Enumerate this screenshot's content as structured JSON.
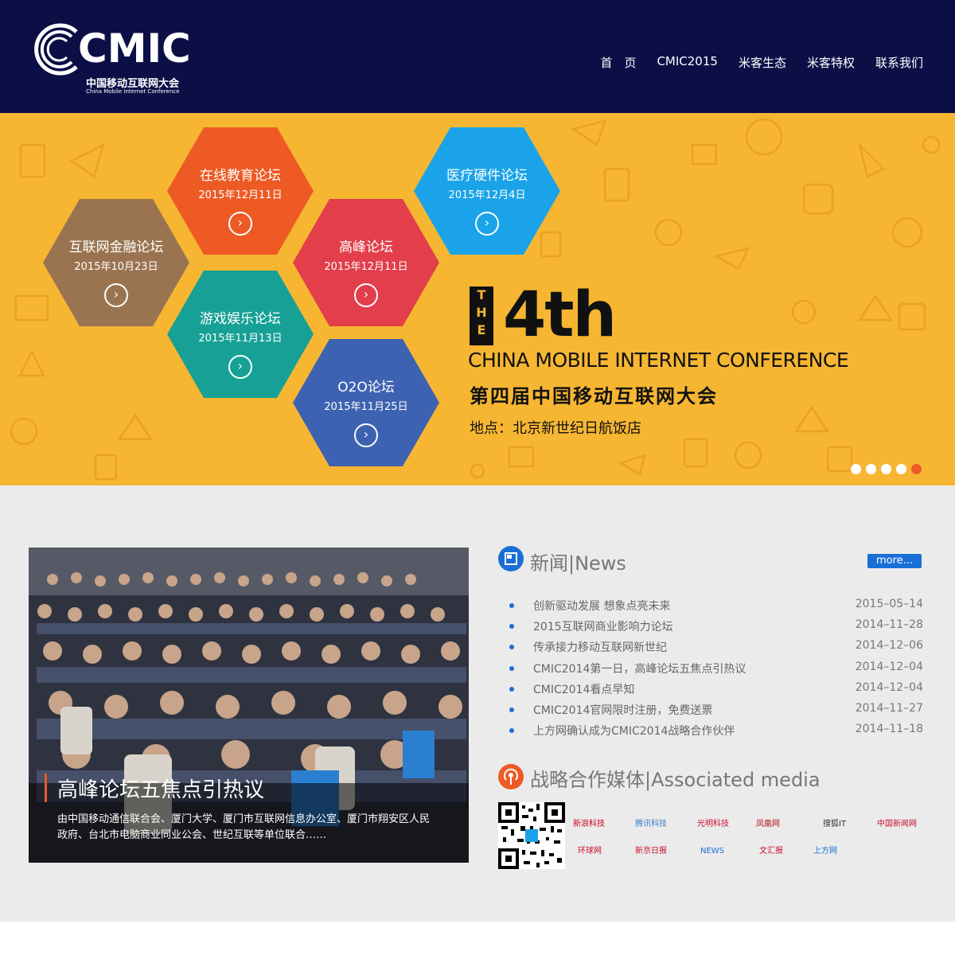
{
  "header": {
    "logo_text": "CMIC",
    "logo_cn": "中国移动互联网大会",
    "logo_en": "China Mobile Internet Conference",
    "nav": [
      "首　页",
      "CMIC2015",
      "米客生态",
      "米客特权",
      "联系我们"
    ]
  },
  "banner": {
    "forums": [
      {
        "title": "在线教育论坛",
        "date": "2015年12月11日",
        "color": "#ee5a24"
      },
      {
        "title": "医疗硬件论坛",
        "date": "2015年12月4日",
        "color": "#1aa3e8"
      },
      {
        "title": "互联网金融论坛",
        "date": "2015年10月23日",
        "color": "#9a7450"
      },
      {
        "title": "高峰论坛",
        "date": "2015年12月11日",
        "color": "#e23e4b"
      },
      {
        "title": "游戏娱乐论坛",
        "date": "2015年11月13日",
        "color": "#17a096"
      },
      {
        "title": "O2O论坛",
        "date": "2015年11月25日",
        "color": "#3e62b2"
      }
    ],
    "the_letters": [
      "T",
      "H",
      "E"
    ],
    "big": "4th",
    "conf_en": "CHINA MOBILE INTERNET CONFERENCE",
    "conf_cn": "第四届中国移动互联网大会",
    "venue": "地点：北京新世纪日航饭店",
    "slides": 5,
    "active_slide": 5
  },
  "feature": {
    "title": "高峰论坛五焦点引热议",
    "desc": "由中国移动通信联合会、厦门大学、厦门市互联网信息办公室、厦门市翔安区人民政府、台北市电脑商业同业公会、世纪互联等单位联合……"
  },
  "news": {
    "title": "新闻|News",
    "more": "more...",
    "items": [
      {
        "text": "创新驱动发展 想象点亮未来",
        "date": "2015–05–14"
      },
      {
        "text": "2015互联网商业影响力论坛",
        "date": "2014–11–28"
      },
      {
        "text": "传承接力移动互联网新世纪",
        "date": "2014–12–06"
      },
      {
        "text": "CMIC2014第一日，高峰论坛五焦点引热议",
        "date": "2014–12–04"
      },
      {
        "text": "CMIC2014看点早知",
        "date": "2014–12–04"
      },
      {
        "text": "CMIC2014官网限时注册，免费送票",
        "date": "2014–11–27"
      },
      {
        "text": "上方网确认成为CMIC2014战略合作伙伴",
        "date": "2014–11–18"
      }
    ]
  },
  "media": {
    "title": "战略合作媒体|Associated media",
    "partners": [
      {
        "name": "新浪科技",
        "color": "#d0021b"
      },
      {
        "name": "腾讯科技",
        "color": "#3b7fc4"
      },
      {
        "name": "光明科技",
        "color": "#c8102e"
      },
      {
        "name": "凤凰网",
        "color": "#b5121b"
      },
      {
        "name": "搜狐IT",
        "color": "#333333"
      },
      {
        "name": "中国新闻网",
        "color": "#c8102e"
      },
      {
        "name": "环球网",
        "color": "#c8102e"
      },
      {
        "name": "新京日报",
        "color": "#c8102e"
      },
      {
        "name": "NEWS",
        "color": "#1a6fd6"
      },
      {
        "name": "文汇报",
        "color": "#c8102e"
      },
      {
        "name": "上方网",
        "color": "#1a6fd6"
      }
    ]
  }
}
